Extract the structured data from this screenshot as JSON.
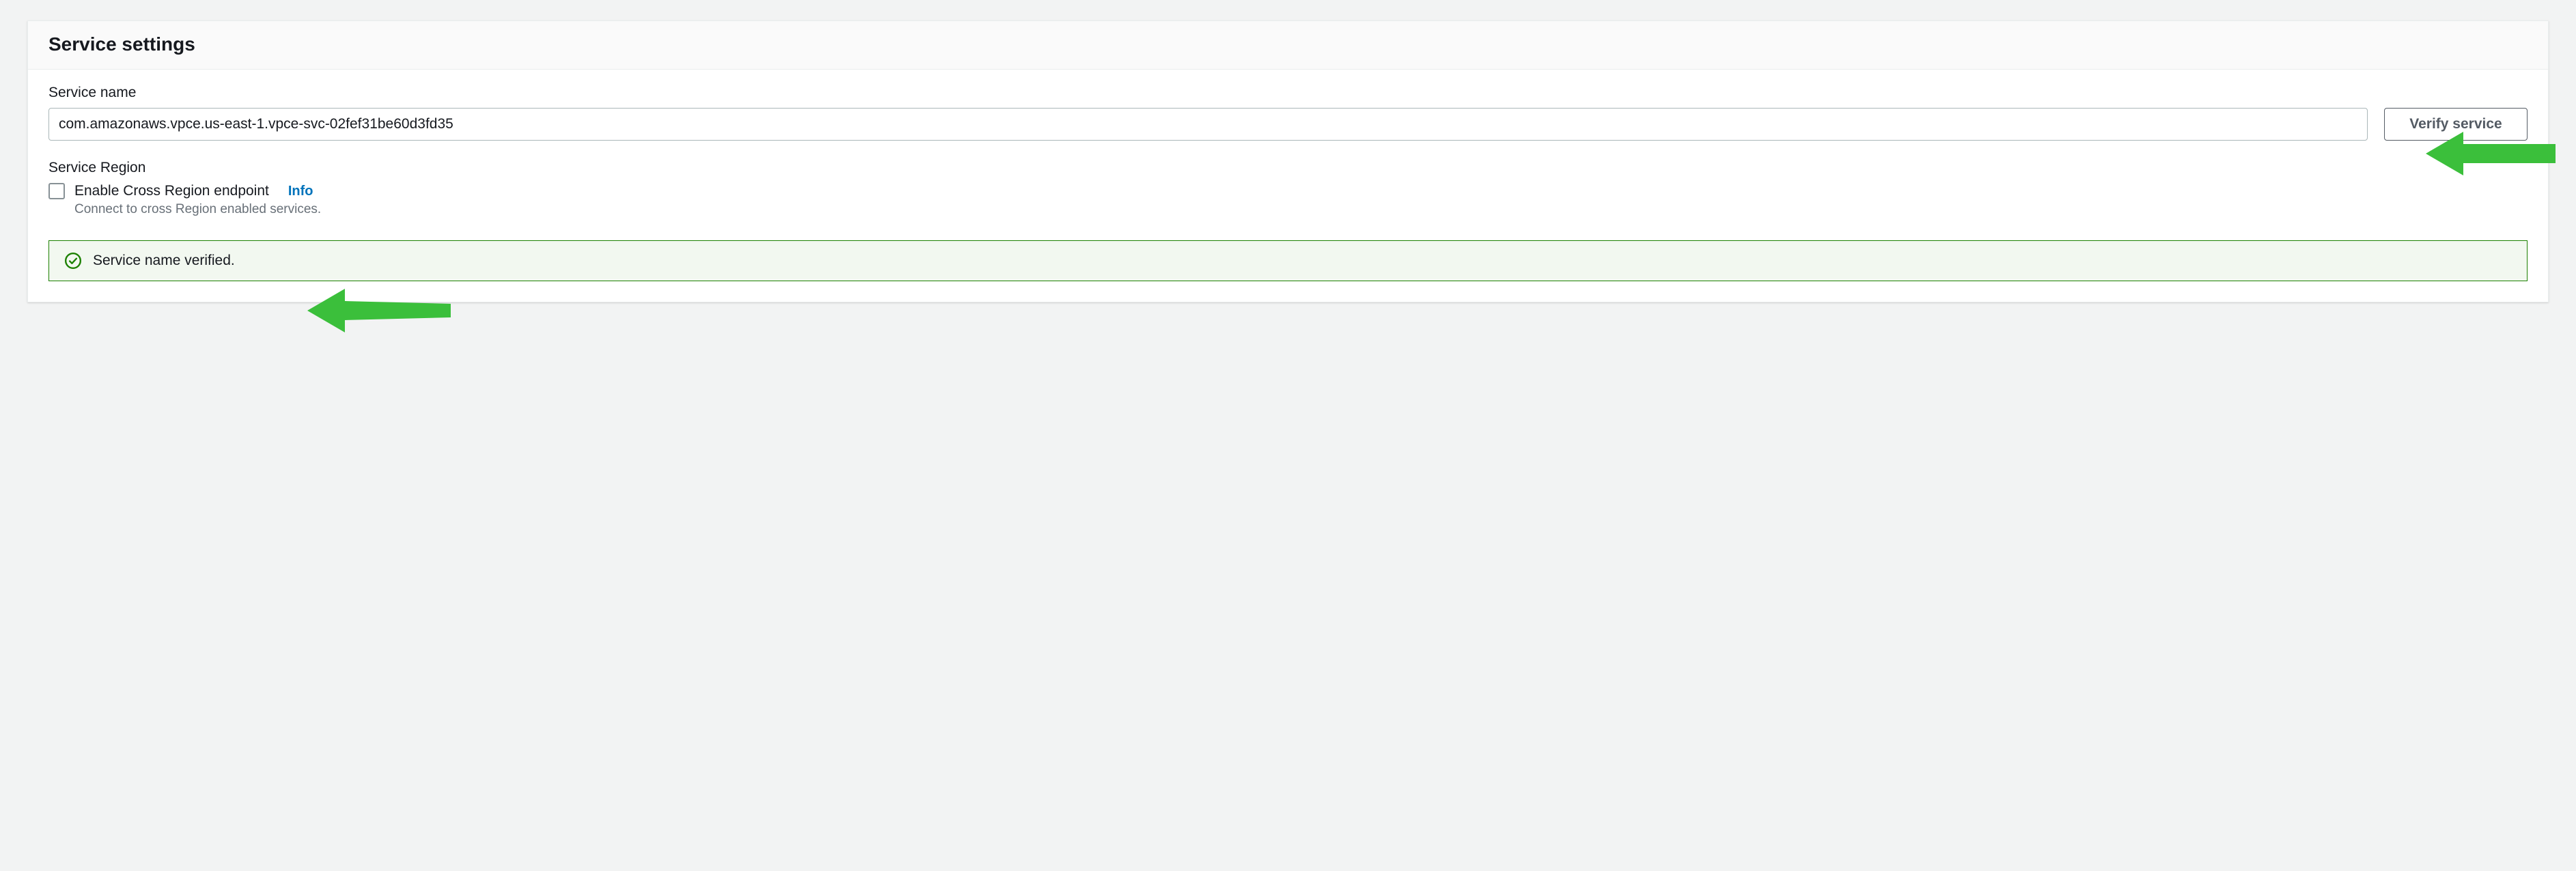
{
  "panel": {
    "title": "Service settings"
  },
  "serviceName": {
    "label": "Service name",
    "value": "com.amazonaws.vpce.us-east-1.vpce-svc-02fef31be60d3fd35",
    "verifyButton": "Verify service"
  },
  "serviceRegion": {
    "label": "Service Region",
    "checkboxLabel": "Enable Cross Region endpoint",
    "infoLink": "Info",
    "helper": "Connect to cross Region enabled services."
  },
  "status": {
    "message": "Service name verified."
  }
}
